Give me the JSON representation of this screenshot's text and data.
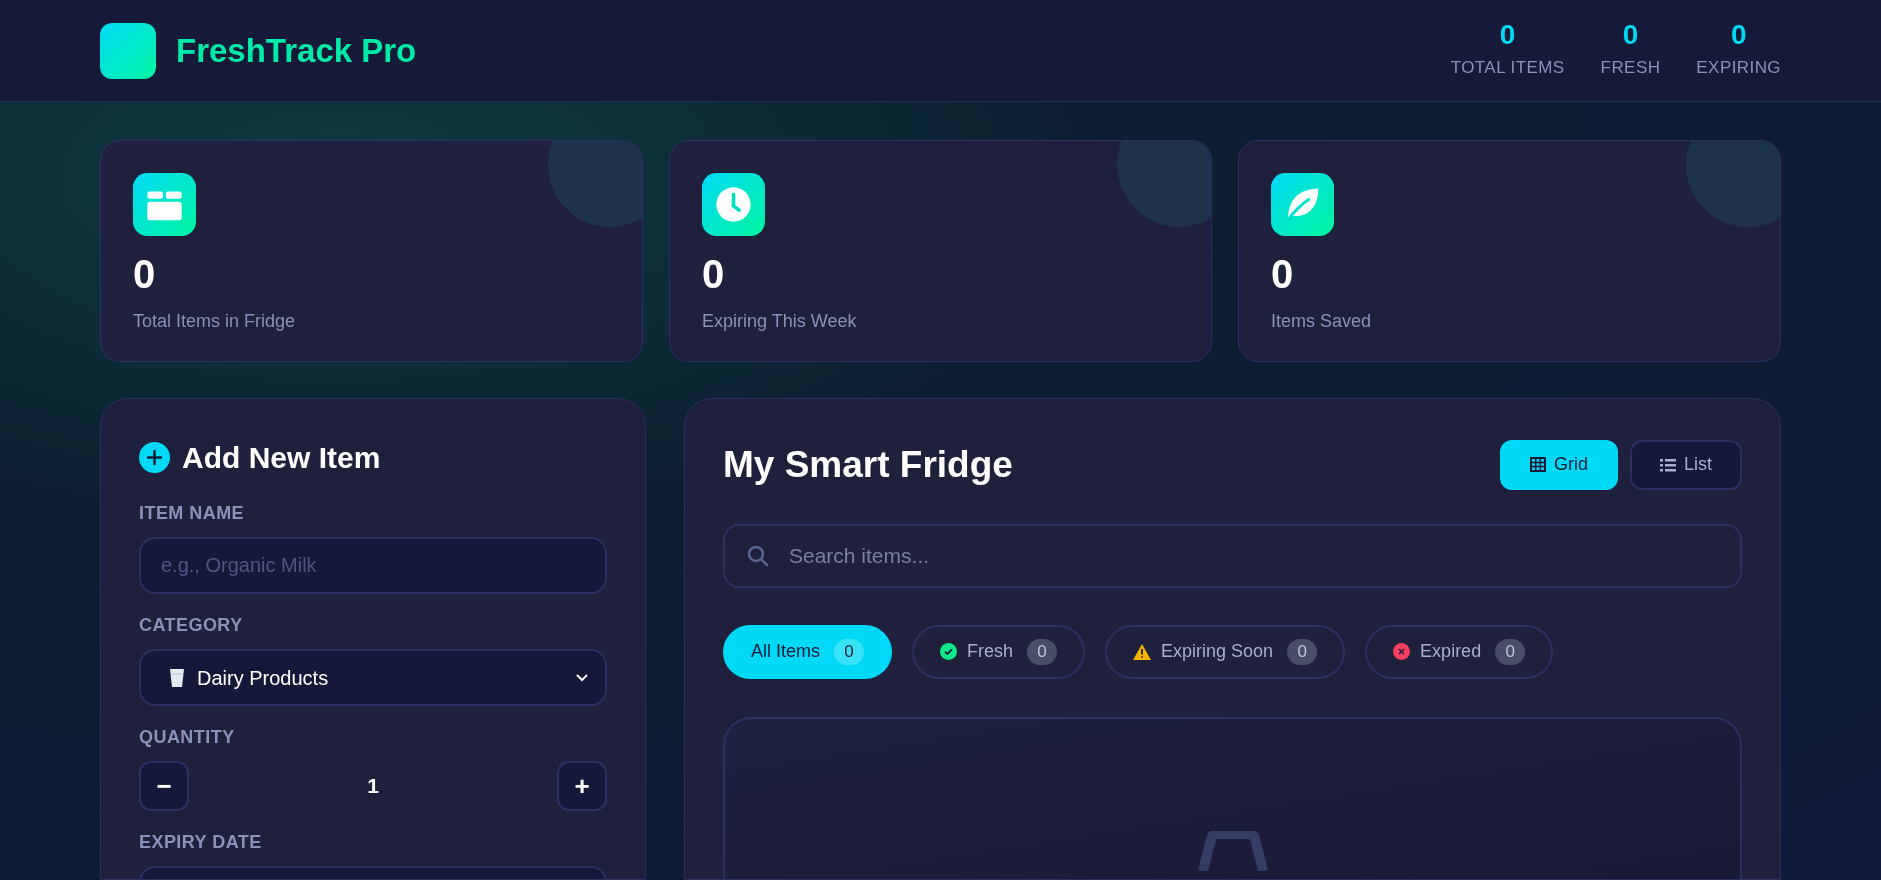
{
  "header": {
    "brand": "FreshTrack Pro",
    "stats": [
      {
        "value": "0",
        "label": "TOTAL ITEMS"
      },
      {
        "value": "0",
        "label": "FRESH"
      },
      {
        "value": "0",
        "label": "EXPIRING"
      }
    ]
  },
  "stat_cards": [
    {
      "value": "0",
      "label": "Total Items in Fridge"
    },
    {
      "value": "0",
      "label": "Expiring This Week"
    },
    {
      "value": "0",
      "label": "Items Saved"
    }
  ],
  "add_item": {
    "title": "Add New Item",
    "fields": [
      {
        "kind": "text",
        "label": "ITEM NAME",
        "placeholder": "e.g., Organic Milk"
      },
      {
        "kind": "select",
        "label": "CATEGORY",
        "value": "Dairy Products"
      },
      {
        "kind": "stepper",
        "label": "QUANTITY",
        "value": "1",
        "decrement": "−",
        "increment": "+"
      },
      {
        "kind": "date",
        "label": "EXPIRY DATE"
      }
    ]
  },
  "fridge": {
    "title": "My Smart Fridge",
    "views": [
      {
        "label": "Grid",
        "selected": true
      },
      {
        "label": "List",
        "selected": false
      }
    ],
    "search": {
      "placeholder": "Search items..."
    },
    "filters": [
      {
        "kind": "plain",
        "label": "All Items",
        "count": "0",
        "selected": true
      },
      {
        "kind": "check",
        "label": "Fresh",
        "count": "0",
        "selected": false,
        "color": "#10e88a"
      },
      {
        "kind": "warning",
        "label": "Expiring Soon",
        "count": "0",
        "selected": false,
        "color": "#f5b400"
      },
      {
        "kind": "cross",
        "label": "Expired",
        "count": "0",
        "selected": false,
        "color": "#f43f5e"
      }
    ]
  }
}
